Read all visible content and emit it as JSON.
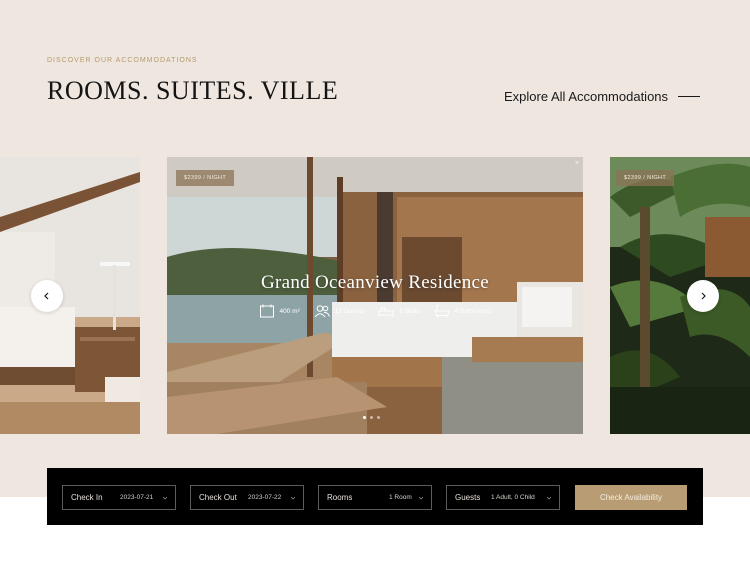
{
  "header": {
    "eyebrow": "DISCOVER OUR ACCOMMODATIONS",
    "title": "ROOMS. SUITES. VILLE",
    "explore_link": "Explore All Accommodations"
  },
  "carousel": {
    "main": {
      "price": "$2399 / NIGHT",
      "name": "Grand Oceanview Residence",
      "features": [
        {
          "icon": "area-icon",
          "label": "400 m²"
        },
        {
          "icon": "guests-icon",
          "label": "12 Guests"
        },
        {
          "icon": "bed-icon",
          "label": "6 Beds"
        },
        {
          "icon": "bath-icon",
          "label": "4 Bathrooms"
        }
      ],
      "slide_count": 3,
      "active_slide": 1
    },
    "right": {
      "price": "$2399 / NIGHT"
    }
  },
  "booking": {
    "check_in": {
      "label": "Check In",
      "value": "2023-07-21"
    },
    "check_out": {
      "label": "Check Out",
      "value": "2023-07-22"
    },
    "rooms": {
      "label": "Rooms",
      "value": "1 Room"
    },
    "guests": {
      "label": "Guests",
      "value": "1 Adult, 0 Child"
    },
    "cta": "Check Availability"
  },
  "colors": {
    "background": "#efe7df",
    "accent": "#b89c74",
    "booking_bar": "#000000"
  }
}
